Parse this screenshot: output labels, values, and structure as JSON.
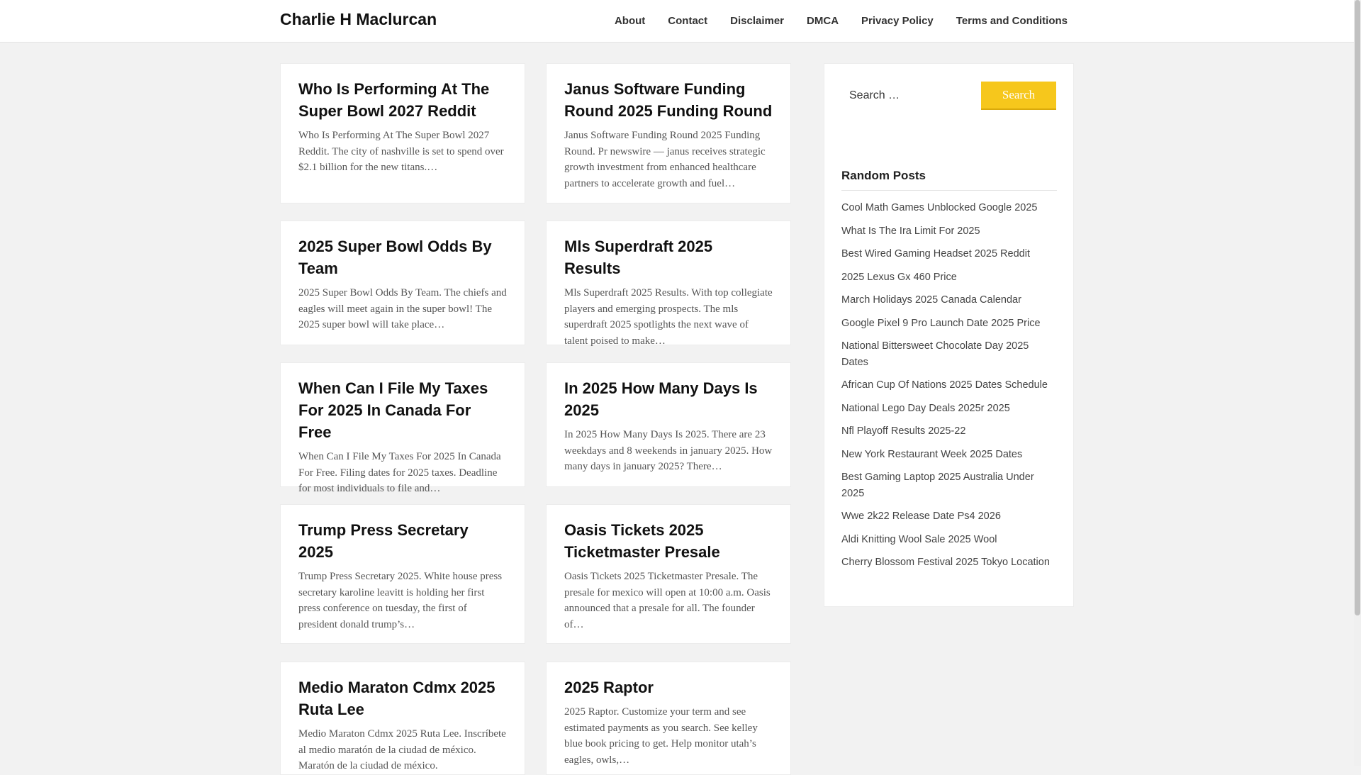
{
  "header": {
    "site_title": "Charlie H Maclurcan",
    "nav": [
      "About",
      "Contact",
      "Disclaimer",
      "DMCA",
      "Privacy Policy",
      "Terms and Conditions"
    ]
  },
  "posts": [
    {
      "title": "Who Is Performing At The Super Bowl 2027 Reddit",
      "excerpt": "Who Is Performing At The Super Bowl 2027 Reddit. The city of nashville is set to spend over $2.1 billion for the new titans.…"
    },
    {
      "title": "Janus Software Funding Round 2025 Funding Round",
      "excerpt": "Janus Software Funding Round 2025 Funding Round. Pr newswire — janus receives strategic growth investment from enhanced healthcare partners to accelerate growth and fuel…"
    },
    {
      "title": "2025 Super Bowl Odds By Team",
      "excerpt": "2025 Super Bowl Odds By Team. The chiefs and eagles will meet again in the super bowl! The 2025 super bowl will take place…"
    },
    {
      "title": "Mls Superdraft 2025 Results",
      "excerpt": "Mls Superdraft 2025 Results. With top collegiate players and emerging prospects. The mls superdraft 2025 spotlights the next wave of talent poised to make…"
    },
    {
      "title": "When Can I File My Taxes For 2025 In Canada For Free",
      "excerpt": "When Can I File My Taxes For 2025 In Canada For Free. Filing dates for 2025 taxes. Deadline for most individuals to file and…"
    },
    {
      "title": "In 2025 How Many Days Is 2025",
      "excerpt": "In 2025 How Many Days Is 2025. There are 23 weekdays and 8 weekends in january 2025. How many days in january 2025? There…"
    },
    {
      "title": "Trump Press Secretary 2025",
      "excerpt": "Trump Press Secretary 2025. White house press secretary karoline leavitt is holding her first press conference on tuesday, the first of president donald trump’s…"
    },
    {
      "title": "Oasis Tickets 2025 Ticketmaster Presale",
      "excerpt": "Oasis Tickets 2025 Ticketmaster Presale. The presale for mexico will open at 10:00 a.m. Oasis announced that a presale for all. The founder of…"
    },
    {
      "title": "Medio Maraton Cdmx 2025 Ruta Lee",
      "excerpt": "Medio Maraton Cdmx 2025 Ruta Lee. Inscríbete al medio maratón de la ciudad de méxico. Maratón de la ciudad de méxico."
    },
    {
      "title": "2025 Raptor",
      "excerpt": "2025 Raptor. Customize your term and see estimated payments as you search. See kelley blue book pricing to get. Help monitor utah’s eagles, owls,…"
    }
  ],
  "sidebar": {
    "search_placeholder": "Search …",
    "search_button": "Search",
    "random_posts_title": "Random Posts",
    "random_posts": [
      "Cool Math Games Unblocked Google 2025",
      "What Is The Ira Limit For 2025",
      "Best Wired Gaming Headset 2025 Reddit",
      "2025 Lexus Gx 460 Price",
      "March Holidays 2025 Canada Calendar",
      "Google Pixel 9 Pro Launch Date 2025 Price",
      "National Bittersweet Chocolate Day 2025 Dates",
      "African Cup Of Nations 2025 Dates Schedule",
      "National Lego Day Deals 2025r 2025",
      "Nfl Playoff Results 2025-22",
      "New York Restaurant Week 2025 Dates",
      "Best Gaming Laptop 2025 Australia Under 2025",
      "Wwe 2k22 Release Date Ps4 2026",
      "Aldi Knitting Wool Sale 2025 Wool",
      "Cherry Blossom Festival 2025 Tokyo Location"
    ]
  }
}
